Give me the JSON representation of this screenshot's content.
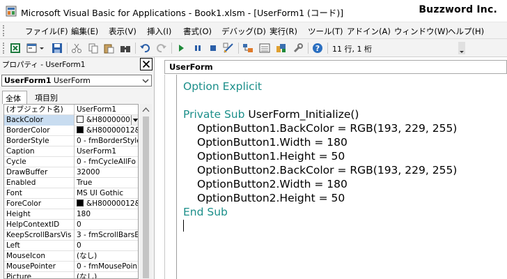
{
  "window": {
    "title": "Microsoft Visual Basic for Applications - Book1.xlsm - [UserForm1 (コード)]",
    "brand": "Buzzword Inc."
  },
  "menu": [
    {
      "label": "ファイル(F)"
    },
    {
      "label": "編集(E)"
    },
    {
      "label": "表示(V)"
    },
    {
      "label": "挿入(I)"
    },
    {
      "label": "書式(O)"
    },
    {
      "label": "デバッグ(D)"
    },
    {
      "label": "実行(R)"
    },
    {
      "label": "ツール(T)"
    },
    {
      "label": "アドイン(A)"
    },
    {
      "label": "ウィンドウ(W)"
    },
    {
      "label": "ヘルプ(H)"
    }
  ],
  "toolbar": {
    "cursor_position": "11 行, 1 桁",
    "buttons": [
      "excel-view-icon",
      "insert-userform-icon",
      "save-icon",
      "cut-icon",
      "copy-icon",
      "paste-icon",
      "find-icon",
      "undo-icon",
      "redo-icon",
      "run-icon",
      "break-icon",
      "reset-icon",
      "design-mode-icon",
      "project-explorer-icon",
      "properties-window-icon",
      "object-browser-icon",
      "toolbox-icon",
      "help-icon"
    ]
  },
  "properties": {
    "title": "プロパティ - UserForm1",
    "object_name": "UserForm1",
    "object_type": "UserForm",
    "tabs": [
      "全体",
      "項目別"
    ],
    "rows": [
      {
        "name": "(オブジェクト名)",
        "value": "UserForm1"
      },
      {
        "name": "BackColor",
        "value": "&H8000000I",
        "swatch": "#ffffff",
        "selected": true,
        "dropdown": true
      },
      {
        "name": "BorderColor",
        "value": "&H80000012&",
        "swatch": "#000000"
      },
      {
        "name": "BorderStyle",
        "value": "0 - fmBorderStyle"
      },
      {
        "name": "Caption",
        "value": "UserForm1"
      },
      {
        "name": "Cycle",
        "value": "0 - fmCycleAllFo"
      },
      {
        "name": "DrawBuffer",
        "value": "32000"
      },
      {
        "name": "Enabled",
        "value": "True"
      },
      {
        "name": "Font",
        "value": "MS UI Gothic"
      },
      {
        "name": "ForeColor",
        "value": "&H80000012&",
        "swatch": "#000000"
      },
      {
        "name": "Height",
        "value": "180"
      },
      {
        "name": "HelpContextID",
        "value": "0"
      },
      {
        "name": "KeepScrollBarsVis",
        "value": "3 - fmScrollBarsE"
      },
      {
        "name": "Left",
        "value": "0"
      },
      {
        "name": "MouseIcon",
        "value": "(なし)"
      },
      {
        "name": "MousePointer",
        "value": "0 - fmMousePoin"
      },
      {
        "name": "Picture",
        "value": "(なし)"
      }
    ]
  },
  "code": {
    "title": "UserForm",
    "lines": [
      {
        "keyword": "Option Explicit",
        "text": "",
        "indent": false
      },
      {
        "keyword": "",
        "text": "",
        "indent": false
      },
      {
        "keyword": "Private Sub",
        "text": " UserForm_Initialize()",
        "indent": false
      },
      {
        "keyword": "",
        "text": "OptionButton1.BackColor = RGB(193, 229, 255)",
        "indent": true
      },
      {
        "keyword": "",
        "text": "OptionButton1.Width = 180",
        "indent": true
      },
      {
        "keyword": "",
        "text": "OptionButton1.Height = 50",
        "indent": true
      },
      {
        "keyword": "",
        "text": "OptionButton2.BackColor = RGB(193, 229, 255)",
        "indent": true
      },
      {
        "keyword": "",
        "text": "OptionButton2.Width = 180",
        "indent": true
      },
      {
        "keyword": "",
        "text": "OptionButton2.Height = 50",
        "indent": true
      },
      {
        "keyword": "End Sub",
        "text": "",
        "indent": false
      }
    ]
  },
  "colors": {
    "keyword": "#1c8f8a",
    "selection": "#c8dcf0"
  }
}
